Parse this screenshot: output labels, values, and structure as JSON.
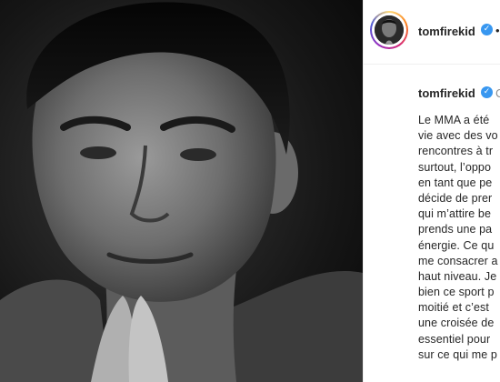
{
  "post": {
    "username": "tomfirekid",
    "verified_icon": "verified-badge-icon",
    "more_glyph": "•",
    "caption_user": "tomfirekid",
    "caption_trailing": "C",
    "caption_lines": [
      "Le MMA a été",
      "vie avec des vo",
      "rencontres à tr",
      "surtout, l’oppo",
      "en tant que pe",
      "décide de prer",
      "qui m’attire be",
      "prends une pa",
      "énergie. Ce qu",
      "me consacrer a",
      "haut niveau. Je",
      "bien ce sport p",
      "moitié et c’est",
      "une croisée de",
      "essentiel pour",
      "sur ce qui me p"
    ]
  },
  "colors": {
    "verified": "#3897f0",
    "text": "#262626",
    "muted": "#8e8e8e"
  }
}
